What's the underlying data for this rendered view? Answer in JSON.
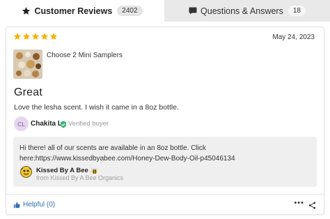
{
  "tabs": [
    {
      "label": "Customer Reviews",
      "count": "2402",
      "icon": "star-icon",
      "active": true
    },
    {
      "label": "Questions & Answers",
      "count": "18",
      "icon": "chat-bubble-icon",
      "active": false
    }
  ],
  "review": {
    "rating": 5,
    "date": "May 24, 2023",
    "product": "Choose 2 Mini Samplers",
    "headline": "Great",
    "body": "Love the lesha scent. I wish it came in a 8oz bottle.",
    "author": {
      "initials": "CL",
      "name": "Chakita L.",
      "verified_label": "Verified buyer"
    },
    "reply": {
      "text": "Hi there! all of our scents are available in an 8oz bottle. Click here:https://www.kissedbyabee.com/Honey-Dew-Body-Oil-p45046134",
      "brand_name": "Kissed By A Bee",
      "brand_sub": "from Kissed By A Bee Organics"
    },
    "helpful_label": "Helpful (0)",
    "more_label": "•••"
  },
  "colors": {
    "star": "#f5b301",
    "link": "#2f6fb3",
    "verified": "#3bb077"
  }
}
